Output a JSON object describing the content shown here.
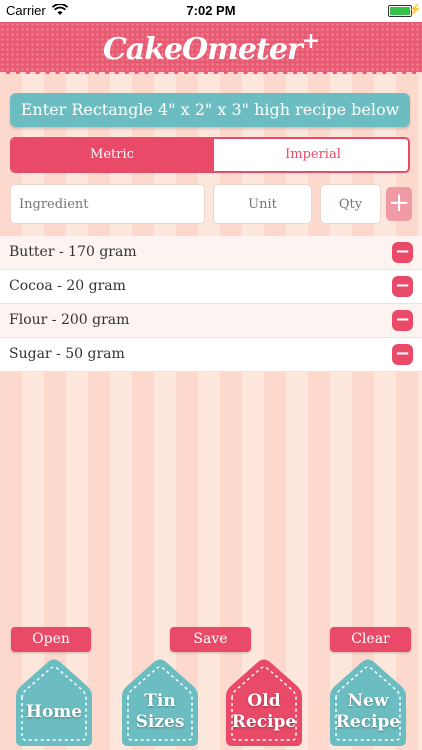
{
  "status_bar": {
    "carrier": "Carrier",
    "time": "7:02 PM",
    "battery_percent": 100
  },
  "app": {
    "title": "CakeOmeter",
    "title_plus": "+"
  },
  "instruction": "Enter Rectangle 4\" x 2\" x 3\" high recipe below",
  "segments": {
    "metric": "Metric",
    "imperial": "Imperial",
    "selected": "Metric"
  },
  "inputs": {
    "ingredient": {
      "placeholder": "Ingredient",
      "value": ""
    },
    "unit": {
      "placeholder": "Unit",
      "value": ""
    },
    "qty": {
      "placeholder": "Qty",
      "value": ""
    },
    "add_label": "+"
  },
  "ingredients": [
    {
      "text": "Butter - 170 gram",
      "remove_label": "−"
    },
    {
      "text": "Cocoa - 20 gram",
      "remove_label": "−"
    },
    {
      "text": "Flour - 200 gram",
      "remove_label": "−"
    },
    {
      "text": "Sugar - 50 gram",
      "remove_label": "−"
    }
  ],
  "actions": {
    "open": "Open",
    "save": "Save",
    "clear": "Clear"
  },
  "tabs": {
    "home": {
      "line1": "Home",
      "line2": ""
    },
    "tin_sizes": {
      "line1": "Tin",
      "line2": "Sizes"
    },
    "old_recipe": {
      "line1": "Old",
      "line2": "Recipe"
    },
    "new_recipe": {
      "line1": "New",
      "line2": "Recipe"
    }
  },
  "colors": {
    "accent": "#e84a68",
    "teal": "#6cbdc1",
    "background_stripe_a": "#fcd9cc",
    "background_stripe_b": "#fde6dc"
  },
  "icons": {
    "wifi": "wifi-icon",
    "battery": "battery-icon",
    "charging": "bolt-icon",
    "add": "plus-icon",
    "remove": "minus-icon"
  }
}
